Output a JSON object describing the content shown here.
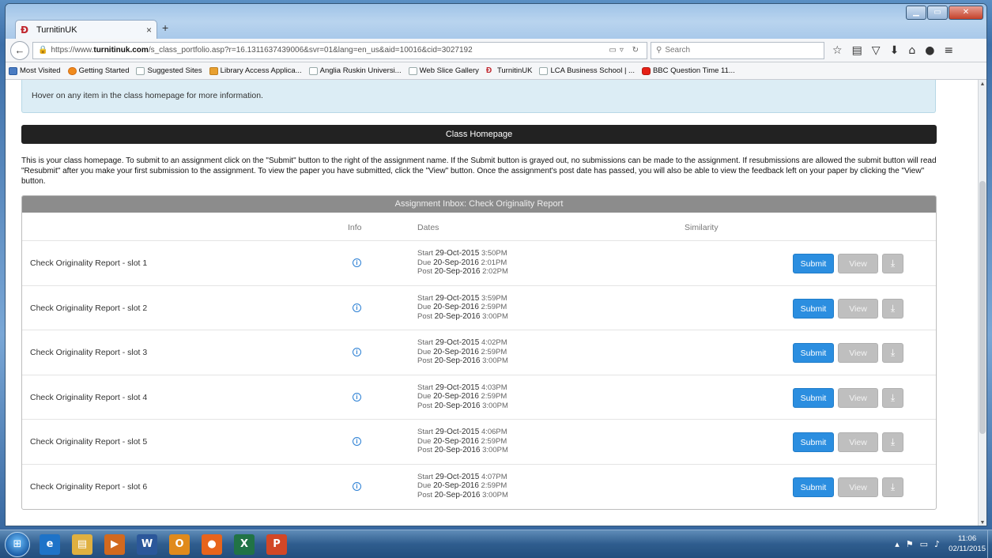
{
  "browser": {
    "tab_title": "TurnitinUK",
    "tab_close": "×",
    "new_tab": "+",
    "url_prefix": "https://www.",
    "url_domain": "turnitinuk.com",
    "url_path": "/s_class_portfolio.asp?r=16.1311637439006&svr=01&lang=en_us&aid=10016&cid=3027192",
    "search_placeholder": "Search",
    "back_icon": "←",
    "bookmarks": [
      {
        "label": "Most Visited",
        "icon": "most-visited-icon"
      },
      {
        "label": "Getting Started",
        "icon": "firefox-icon"
      },
      {
        "label": "Suggested Sites",
        "icon": "page-icon"
      },
      {
        "label": "Library Access Applica...",
        "icon": "library-icon"
      },
      {
        "label": "Anglia Ruskin Universi...",
        "icon": "page-icon"
      },
      {
        "label": "Web Slice Gallery",
        "icon": "page-icon"
      },
      {
        "label": "TurnitinUK",
        "icon": "turnitin-icon"
      },
      {
        "label": "LCA Business School | ...",
        "icon": "page-icon"
      },
      {
        "label": "BBC Question Time 11...",
        "icon": "youtube-icon"
      }
    ]
  },
  "page": {
    "info_text": "Hover on any item in the class homepage for more information.",
    "section_title": "Class Homepage",
    "intro_text": "This is your class homepage. To submit to an assignment click on the \"Submit\" button to the right of the assignment name. If the Submit button is grayed out, no submissions can be made to the assignment. If resubmissions are allowed the submit button will read \"Resubmit\" after you make your first submission to the assignment. To view the paper you have submitted, click the \"View\" button. Once the assignment's post date has passed, you will also be able to view the feedback left on your paper by clicking the \"View\" button.",
    "inbox_title": "Assignment Inbox: Check Originality Report",
    "columns": {
      "info": "Info",
      "dates": "Dates",
      "similarity": "Similarity"
    },
    "labels": {
      "start": "Start",
      "due": "Due",
      "post": "Post",
      "submit": "Submit",
      "view": "View"
    },
    "assignments": [
      {
        "title": "Check Originality Report - slot 1",
        "start_date": "29-Oct-2015",
        "start_time": "3:50PM",
        "due_date": "20-Sep-2016",
        "due_time": "2:01PM",
        "post_date": "20-Sep-2016",
        "post_time": "2:02PM"
      },
      {
        "title": "Check Originality Report - slot 2",
        "start_date": "29-Oct-2015",
        "start_time": "3:59PM",
        "due_date": "20-Sep-2016",
        "due_time": "2:59PM",
        "post_date": "20-Sep-2016",
        "post_time": "3:00PM"
      },
      {
        "title": "Check Originality Report - slot 3",
        "start_date": "29-Oct-2015",
        "start_time": "4:02PM",
        "due_date": "20-Sep-2016",
        "due_time": "2:59PM",
        "post_date": "20-Sep-2016",
        "post_time": "3:00PM"
      },
      {
        "title": "Check Originality Report - slot 4",
        "start_date": "29-Oct-2015",
        "start_time": "4:03PM",
        "due_date": "20-Sep-2016",
        "due_time": "2:59PM",
        "post_date": "20-Sep-2016",
        "post_time": "3:00PM"
      },
      {
        "title": "Check Originality Report - slot 5",
        "start_date": "29-Oct-2015",
        "start_time": "4:06PM",
        "due_date": "20-Sep-2016",
        "due_time": "2:59PM",
        "post_date": "20-Sep-2016",
        "post_time": "3:00PM"
      },
      {
        "title": "Check Originality Report - slot 6",
        "start_date": "29-Oct-2015",
        "start_time": "4:07PM",
        "due_date": "20-Sep-2016",
        "due_time": "2:59PM",
        "post_date": "20-Sep-2016",
        "post_time": "3:00PM"
      }
    ]
  },
  "taskbar": {
    "clock_time": "11:06",
    "clock_date": "02/11/2015",
    "apps": [
      {
        "name": "ie",
        "glyph": "e",
        "color": "#1e73c8"
      },
      {
        "name": "explorer",
        "glyph": "▤",
        "color": "#e0b040"
      },
      {
        "name": "media",
        "glyph": "▶",
        "color": "#d2691e"
      },
      {
        "name": "word",
        "glyph": "W",
        "color": "#2b579a"
      },
      {
        "name": "outlook",
        "glyph": "O",
        "color": "#e08a1c"
      },
      {
        "name": "firefox",
        "glyph": "●",
        "color": "#e8641c"
      },
      {
        "name": "excel",
        "glyph": "X",
        "color": "#217346"
      },
      {
        "name": "powerpoint",
        "glyph": "P",
        "color": "#d24726"
      }
    ]
  },
  "colors": {
    "submit": "#2b8ee0",
    "view": "#bfbfbf",
    "header": "#222222",
    "info_box": "#dcedf5"
  }
}
